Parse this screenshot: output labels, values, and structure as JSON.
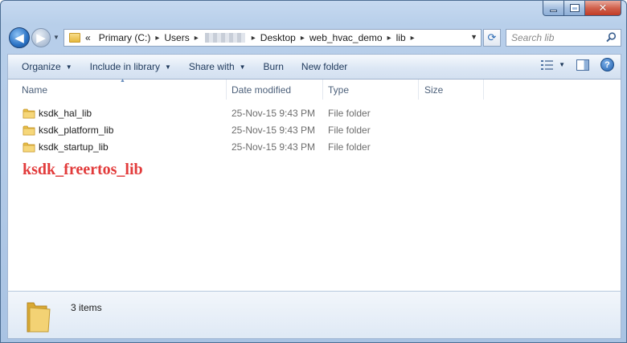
{
  "window": {
    "minimize_label": "",
    "maximize_label": "",
    "close_label": "✕"
  },
  "nav": {
    "back_glyph": "◀",
    "forward_glyph": "▶",
    "recent_glyph": "▼"
  },
  "address": {
    "overflow": "«",
    "crumbs": [
      "Primary (C:)",
      "Users",
      "Desktop",
      "web_hvac_demo",
      "lib"
    ],
    "dropdown": "▼"
  },
  "refresh_glyph": "⟳",
  "search": {
    "placeholder": "Search lib"
  },
  "toolbar": {
    "organize": "Organize",
    "include_in_library": "Include in library",
    "share_with": "Share with",
    "burn": "Burn",
    "new_folder": "New folder",
    "help": "?"
  },
  "columns": {
    "name": "Name",
    "date_modified": "Date modified",
    "type": "Type",
    "size": "Size"
  },
  "files": [
    {
      "name": "ksdk_hal_lib",
      "date": "25-Nov-15 9:43 PM",
      "type": "File folder"
    },
    {
      "name": "ksdk_platform_lib",
      "date": "25-Nov-15 9:43 PM",
      "type": "File folder"
    },
    {
      "name": "ksdk_startup_lib",
      "date": "25-Nov-15 9:43 PM",
      "type": "File folder"
    }
  ],
  "annotation": "ksdk_freertos_lib",
  "details": {
    "item_count": "3 items"
  },
  "colors": {
    "annotation": "#e23b3b",
    "folder": "#e6b83c",
    "header_text": "#4c607a"
  },
  "icons": {
    "sort": "sort-ascending-icon",
    "folder": "folder-icon",
    "search": "search-icon"
  }
}
